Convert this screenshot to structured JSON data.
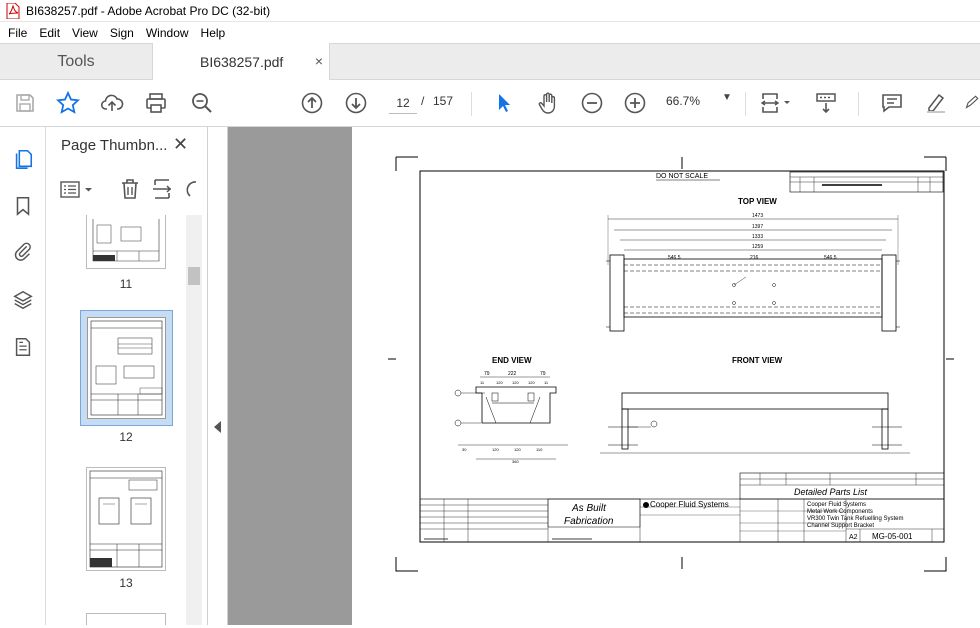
{
  "window": {
    "title": "BI638257.pdf - Adobe Acrobat Pro DC (32-bit)"
  },
  "menu": [
    "File",
    "Edit",
    "View",
    "Sign",
    "Window",
    "Help"
  ],
  "tabs": {
    "tools": "Tools",
    "document": "BI638257.pdf",
    "close": "×"
  },
  "toolbar": {
    "page_current": "12",
    "page_sep": "/",
    "page_total": "157",
    "zoom": "66.7%"
  },
  "panel": {
    "title": "Page Thumbn...",
    "thumbnails": [
      {
        "label": "11"
      },
      {
        "label": "12"
      },
      {
        "label": "13"
      }
    ]
  },
  "drawing": {
    "do_not_scale": "DO  NOT  SCALE",
    "top_view": "TOP VIEW",
    "end_view": "END VIEW",
    "front_view": "FRONT VIEW",
    "dims_top": [
      "1473",
      "1397",
      "1333",
      "1259"
    ],
    "dims_top_mid": [
      "546.5",
      "216",
      "546.5"
    ],
    "dims_end_top": [
      "79",
      "222",
      "79"
    ],
    "dims_end_mid": [
      "11",
      "120",
      "120",
      "120",
      "11"
    ],
    "dims_end_bot": [
      "30",
      "120",
      "120",
      "110",
      "360"
    ],
    "as_built_1": "As Built",
    "as_built_2": "Fabrication",
    "company": "Cooper Fluid Systems",
    "title_lines": [
      "Cooper Fluid Systems",
      "Metal Work Components",
      "VR300 Twin Tank Refuelling System",
      "Channel Support Bracket"
    ],
    "drawing_no": "MG-05-001",
    "size": "A2",
    "parts_list": "Detailed Parts List"
  },
  "colors": {
    "accent": "#1473e6",
    "viewer_bg": "#9a9a9a",
    "panel_border": "#d0d0d0"
  }
}
